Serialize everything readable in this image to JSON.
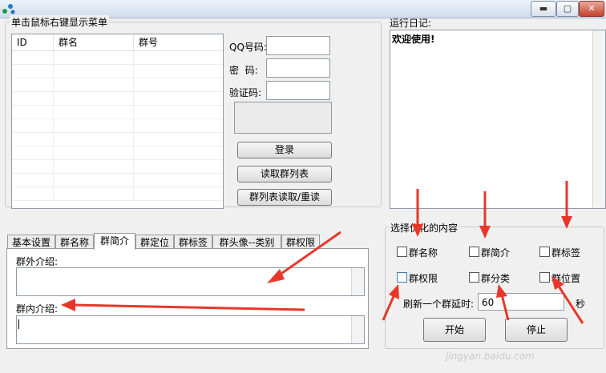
{
  "window": {
    "minimize_glyph": "▬",
    "maximize_glyph": "▢",
    "close_glyph": "✕"
  },
  "left_group": {
    "title": "单击鼠标右键显示菜单",
    "columns": [
      "ID",
      "群名",
      "群号"
    ]
  },
  "login": {
    "qq_label": "QQ号码:",
    "pwd_label": "密  码:",
    "captcha_label": "验证码:",
    "qq_value": "",
    "pwd_value": "",
    "captcha_value": "",
    "login_button": "登录",
    "read_list_button": "读取群列表",
    "reread_button": "群列表读取/重读"
  },
  "tabs": [
    "基本设置",
    "群名称",
    "群简介",
    "群定位",
    "群标签",
    "群头像--类别",
    "群权限"
  ],
  "active_tab_index": 2,
  "tab_panel": {
    "outer_intro_label": "群外介绍:",
    "inner_intro_label": "群内介绍:"
  },
  "log": {
    "title": "运行日记:",
    "text": "欢迎使用!"
  },
  "options": {
    "title": "选择优化的内容",
    "checkboxes": [
      "群名称",
      "群简介",
      "群标签",
      "群权限",
      "群分类",
      "群位置"
    ],
    "delay_label": "刷新一个群延时:",
    "delay_value": "60",
    "seconds_label": "秒",
    "start_button": "开始",
    "stop_button": "停止"
  },
  "watermark": "jingyan.baidu.com",
  "colors": {
    "annotation_arrow": "#e8372a",
    "title_bar": "#dbe5f1"
  },
  "icons": [
    "app-logo-icon",
    "minimize-icon",
    "maximize-icon",
    "close-icon"
  ]
}
